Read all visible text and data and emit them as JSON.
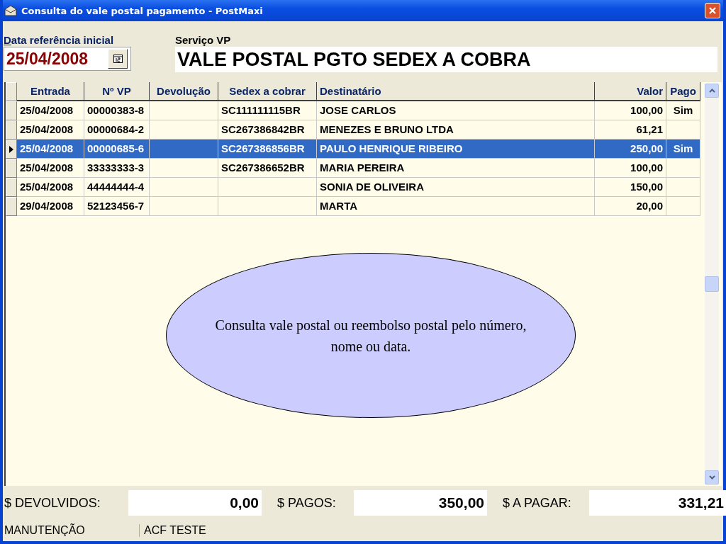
{
  "window": {
    "title": "Consulta do vale postal pagamento - PostMaxi"
  },
  "date_field": {
    "label": "Data referência inicial",
    "value": "25/04/2008"
  },
  "service": {
    "label": "Serviço VP",
    "value": "VALE POSTAL PGTO SEDEX A COBRA"
  },
  "table": {
    "columns": [
      {
        "label": "Entrada"
      },
      {
        "label": "Nº VP"
      },
      {
        "label": "Devolução"
      },
      {
        "label": "Sedex a cobrar"
      },
      {
        "label": "Destinatário"
      },
      {
        "label": "Valor"
      },
      {
        "label": "Pago"
      }
    ],
    "rows": [
      {
        "selected": false,
        "cells": [
          "25/04/2008",
          "00000383-8",
          "",
          "SC111111115BR",
          "JOSE CARLOS",
          "100,00",
          "Sim"
        ]
      },
      {
        "selected": false,
        "cells": [
          "25/04/2008",
          "00000684-2",
          "",
          "SC267386842BR",
          "MENEZES E BRUNO LTDA",
          "61,21",
          ""
        ]
      },
      {
        "selected": true,
        "cells": [
          "25/04/2008",
          "00000685-6",
          "",
          "SC267386856BR",
          "PAULO HENRIQUE RIBEIRO",
          "250,00",
          "Sim"
        ]
      },
      {
        "selected": false,
        "cells": [
          "25/04/2008",
          "33333333-3",
          "",
          "SC267386652BR",
          "MARIA PEREIRA",
          "100,00",
          ""
        ]
      },
      {
        "selected": false,
        "cells": [
          "25/04/2008",
          "44444444-4",
          "",
          "",
          "SONIA DE OLIVEIRA",
          "150,00",
          ""
        ]
      },
      {
        "selected": false,
        "cells": [
          "29/04/2008",
          "52123456-7",
          "",
          "",
          "MARTA",
          "20,00",
          ""
        ]
      }
    ]
  },
  "callout": {
    "text": "Consulta vale postal ou reembolso postal pelo número, nome ou data."
  },
  "totals": [
    {
      "label": "$ DEVOLVIDOS:",
      "value": "0,00"
    },
    {
      "label": "$ PAGOS:",
      "value": "350,00"
    },
    {
      "label": "$ A PAGAR:",
      "value": "331,21"
    }
  ],
  "status_bar": [
    "MANUTENÇÃO",
    "ACF TESTE"
  ]
}
